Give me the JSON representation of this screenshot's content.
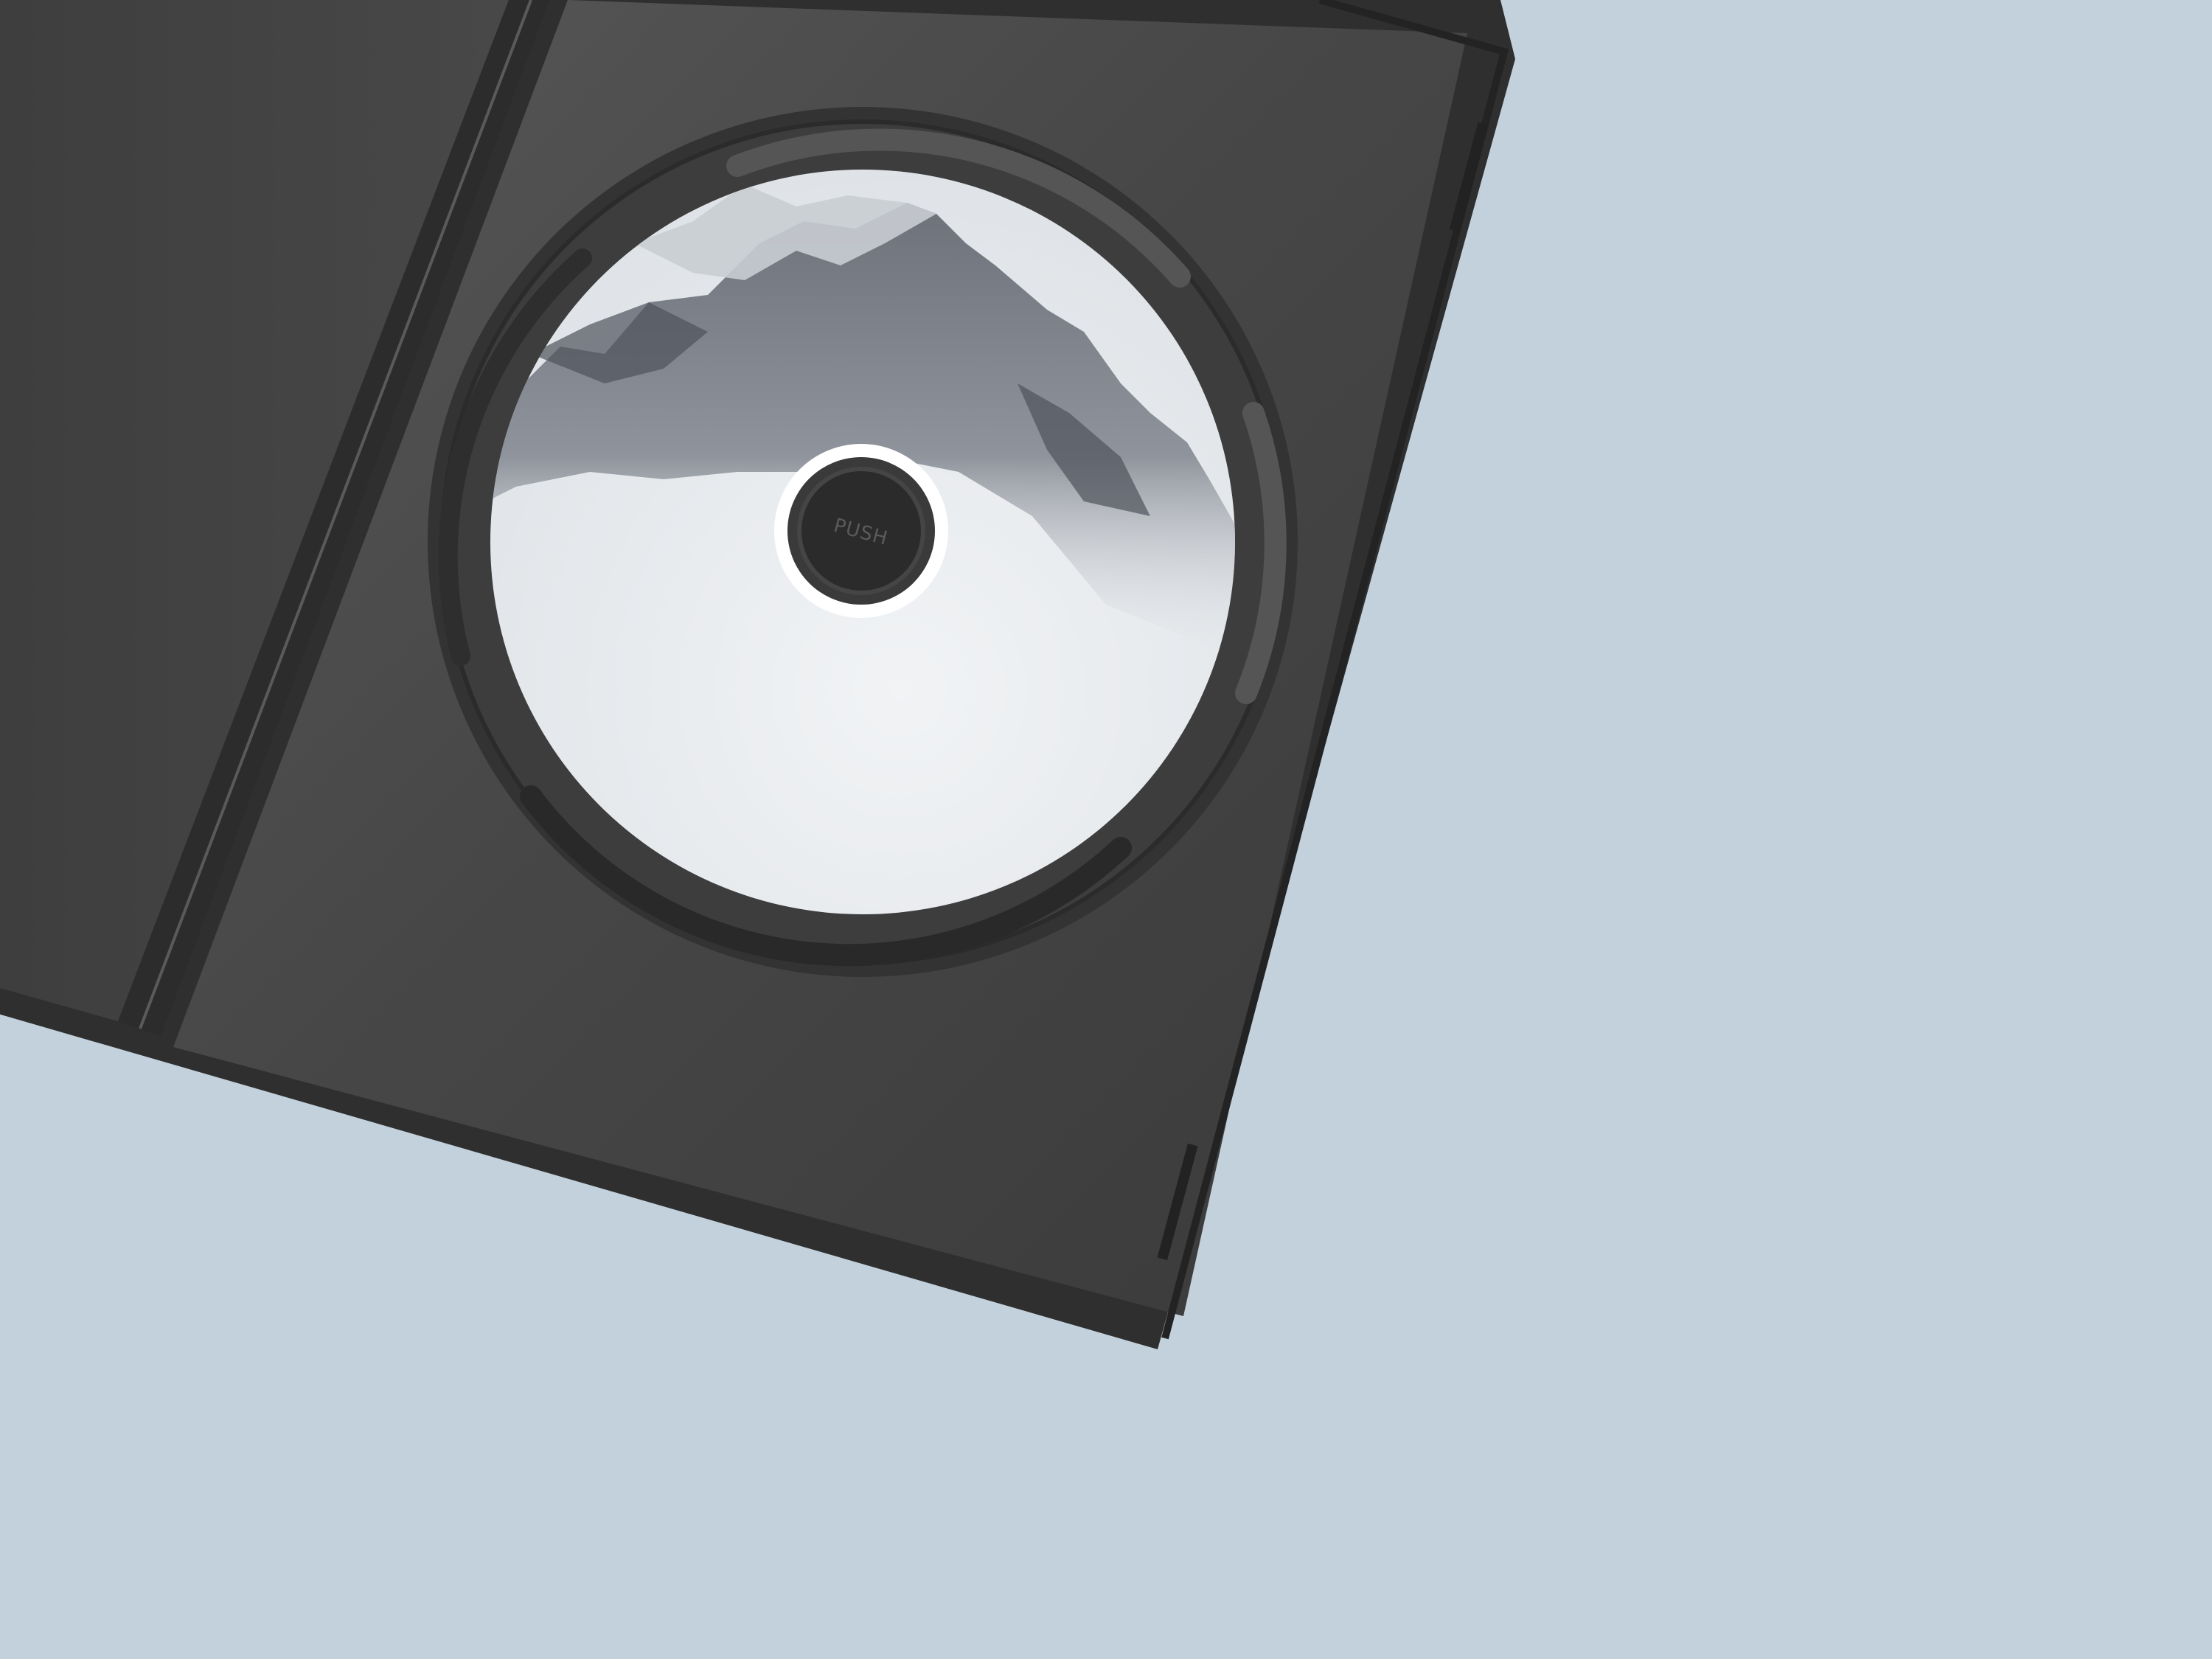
{
  "scene": {
    "background_color": "#c2d1dc",
    "case_color": "#3b3b3b",
    "case_edge_color": "#2a2a2a",
    "disc_color": "#e6e9ec",
    "hub_ring_color": "#ffffff",
    "hub_button_color": "#2b2b2b"
  },
  "disc": {
    "hub_label": "PUSH",
    "artwork": "snowy-mountain-peaks"
  }
}
